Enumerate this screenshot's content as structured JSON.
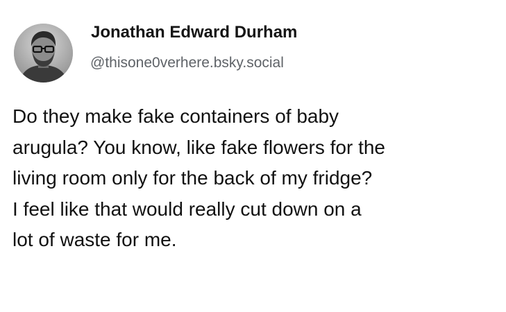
{
  "post": {
    "author": {
      "name": "Jonathan Edward Durham",
      "handle": "@thisone0verhere.bsky.social",
      "avatar_icon": "user-avatar-photo"
    },
    "body_lines": [
      "Do they make fake containers of baby",
      "arugula? You know, like fake flowers for the",
      "living room only for the back of my fridge?",
      "I feel like that would really cut down on a",
      "lot of waste for me."
    ]
  },
  "colors": {
    "background": "#ffffff",
    "name_text": "#151515",
    "handle_text": "#5f6368",
    "body_text": "#121212"
  }
}
